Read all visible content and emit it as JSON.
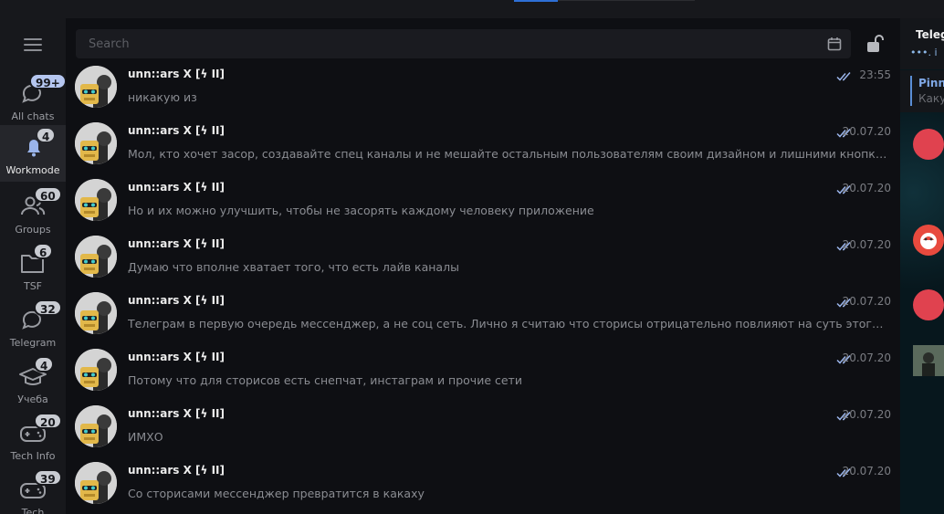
{
  "search": {
    "placeholder": "Search"
  },
  "folders": [
    {
      "label": "All chats",
      "badge": "99+",
      "icon": "chat-bubble-icon",
      "active": false
    },
    {
      "label": "Workmode",
      "badge": "4",
      "icon": "bell-icon",
      "active": true
    },
    {
      "label": "Groups",
      "badge": "60",
      "icon": "users-icon",
      "active": false
    },
    {
      "label": "TSF",
      "badge": "6",
      "icon": "folder-icon",
      "active": false
    },
    {
      "label": "Telegram",
      "badge": "32",
      "icon": "chat-bubble-icon",
      "active": false
    },
    {
      "label": "Учеба",
      "badge": "4",
      "icon": "graduation-cap-icon",
      "active": false
    },
    {
      "label": "Tech Info",
      "badge": "20",
      "icon": "gamepad-icon",
      "active": false
    },
    {
      "label": "Tech",
      "badge": "39",
      "icon": "gamepad-icon",
      "active": false
    }
  ],
  "messages": [
    {
      "sender": "unn::ars X [ϟ II]",
      "text": "никакую из",
      "time": "23:55",
      "read": true
    },
    {
      "sender": "unn::ars X [ϟ II]",
      "text": "Мол, кто хочет засор, создавайте спец каналы и не мешайте остальным пользователям своим дизайном и лишними кнопками",
      "time": "20.07.20",
      "read": true
    },
    {
      "sender": "unn::ars X [ϟ II]",
      "text": "Но и их можно улучшить, чтобы не засорять каждому человеку приложение",
      "time": "20.07.20",
      "read": true
    },
    {
      "sender": "unn::ars X [ϟ II]",
      "text": "Думаю что вполне хватает того, что есть лайв каналы",
      "time": "20.07.20",
      "read": true
    },
    {
      "sender": "unn::ars X [ϟ II]",
      "text": "Телеграм в первую очередь мессенджер, а не соц сеть. Лично я считаю что сторисы отрицательно повлияют на суть этого прилож...",
      "time": "20.07.20",
      "read": true
    },
    {
      "sender": "unn::ars X [ϟ II]",
      "text": "Потому что для сторисов есть снепчат, инстаграм и прочие сети",
      "time": "20.07.20",
      "read": true
    },
    {
      "sender": "unn::ars X [ϟ II]",
      "text": "ИМХО",
      "time": "20.07.20",
      "read": true
    },
    {
      "sender": "unn::ars X [ϟ II]",
      "text": "Со сторисами мессенджер превратится в какаху",
      "time": "20.07.20",
      "read": true
    }
  ],
  "right_panel": {
    "title": "Teleg",
    "status": "•••. i",
    "pinned_title": "Pinn",
    "pinned_text": "Каку"
  },
  "colors": {
    "accent": "#2e6fd6",
    "avatar_red": "#e0424f"
  }
}
